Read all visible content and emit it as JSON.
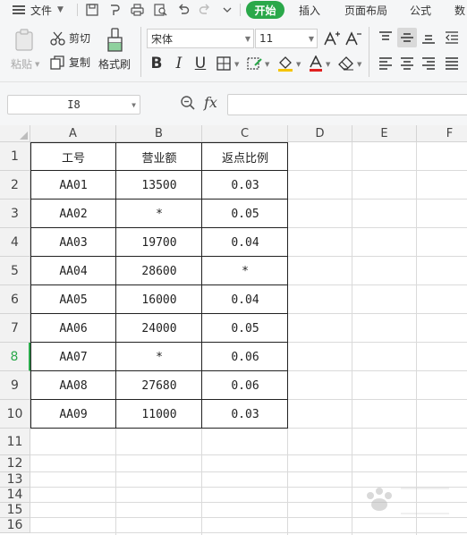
{
  "menubar": {
    "file_label": "文件",
    "tabs": [
      {
        "label": "开始",
        "active": true
      },
      {
        "label": "插入",
        "active": false
      },
      {
        "label": "页面布局",
        "active": false
      },
      {
        "label": "公式",
        "active": false
      },
      {
        "label": "数",
        "active": false
      }
    ]
  },
  "ribbon": {
    "paste_label": "粘贴",
    "cut_label": "剪切",
    "copy_label": "复制",
    "format_painter_label": "格式刷",
    "font_name": "宋体",
    "font_size": "11",
    "accent_color": "#2aa84a"
  },
  "formula_bar": {
    "name_box": "I8",
    "fx_label": "fx",
    "formula_value": ""
  },
  "sheet": {
    "columns": [
      "A",
      "B",
      "C",
      "D",
      "E",
      "F"
    ],
    "rows": [
      "1",
      "2",
      "3",
      "4",
      "5",
      "6",
      "7",
      "8",
      "9",
      "10",
      "11",
      "12",
      "13",
      "14",
      "15",
      "16"
    ],
    "active_row": "8",
    "table": [
      [
        "工号",
        "营业额",
        "返点比例"
      ],
      [
        "AA01",
        "13500",
        "0.03"
      ],
      [
        "AA02",
        "*",
        "0.05"
      ],
      [
        "AA03",
        "19700",
        "0.04"
      ],
      [
        "AA04",
        "28600",
        "*"
      ],
      [
        "AA05",
        "16000",
        "0.04"
      ],
      [
        "AA06",
        "24000",
        "0.05"
      ],
      [
        "AA07",
        "*",
        "0.06"
      ],
      [
        "AA08",
        "27680",
        "0.06"
      ],
      [
        "AA09",
        "11000",
        "0.03"
      ]
    ]
  }
}
